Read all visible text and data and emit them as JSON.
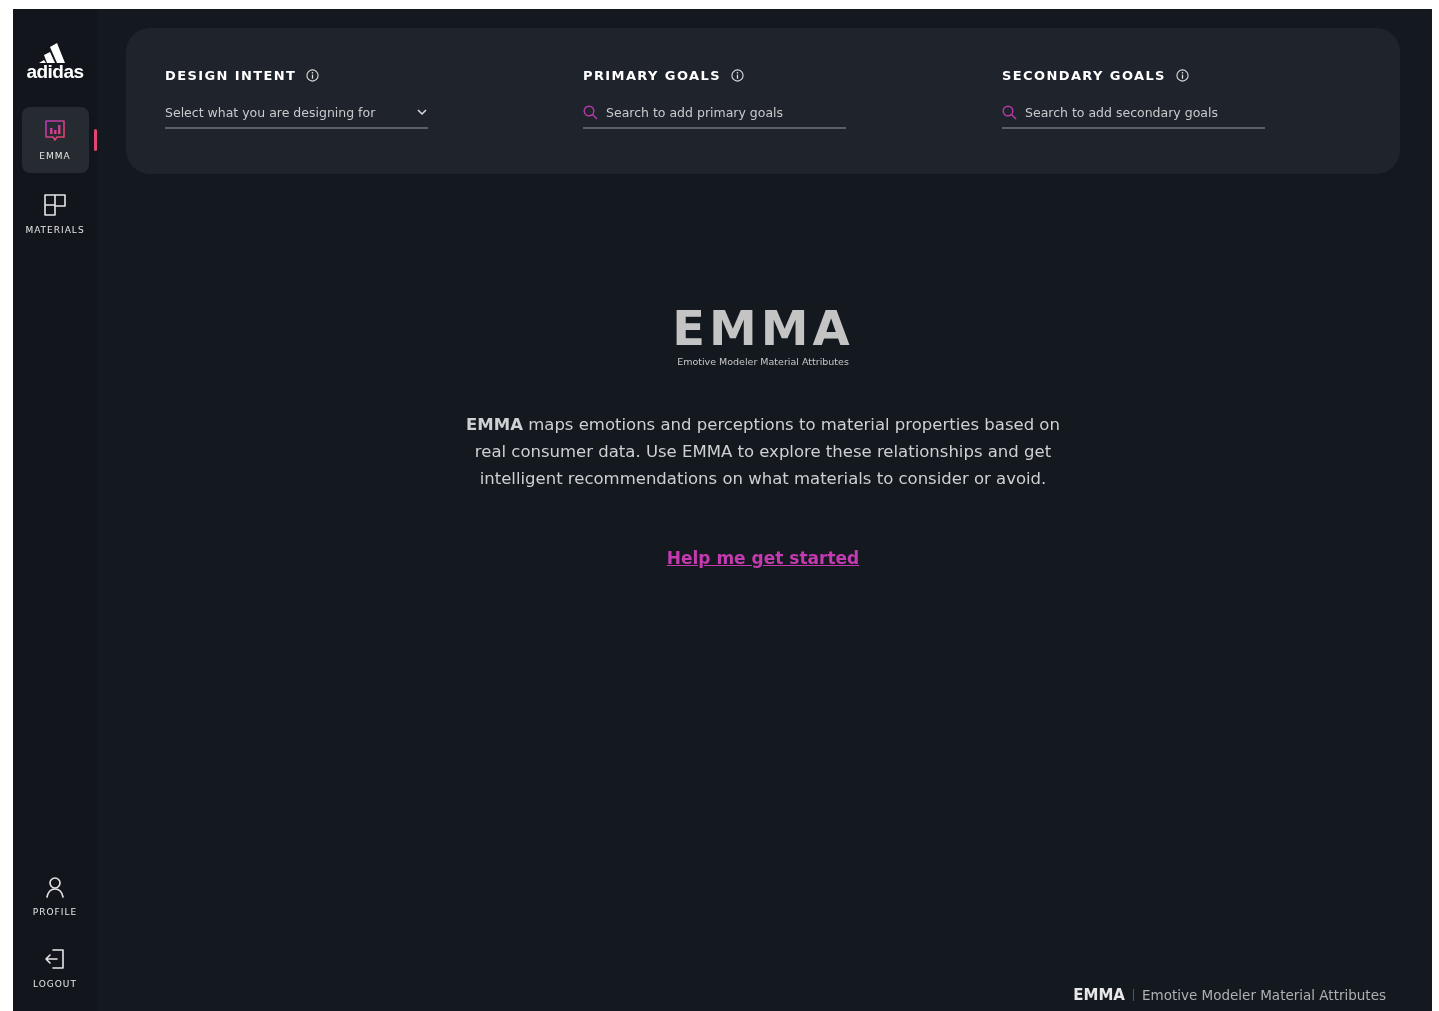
{
  "sidebar": {
    "logo": "adidas",
    "nav": [
      {
        "label": "EMMA",
        "kind": "chart",
        "selected": true
      },
      {
        "label": "MATERIALS",
        "kind": "grid",
        "selected": false
      }
    ],
    "bottom": [
      {
        "label": "PROFILE",
        "kind": "person"
      },
      {
        "label": "LOGOUT",
        "kind": "logout"
      }
    ]
  },
  "filters": [
    {
      "label": "DESIGN INTENT",
      "kind": "select",
      "placeholder": "Select what you are designing for"
    },
    {
      "label": "PRIMARY GOALS",
      "kind": "search",
      "placeholder": "Search to add primary goals"
    },
    {
      "label": "SECONDARY GOALS",
      "kind": "search",
      "placeholder": "Search to add secondary goals"
    }
  ],
  "hero": {
    "title": "EMMA",
    "subtitle": "Emotive Modeler Material Attributes",
    "description": "**EMMA** maps emotions and perceptions to material properties based on real consumer data. Use EMMA to explore these relationships and get intelligent recommendations on what materials to consider or avoid.",
    "link": "Help me get started"
  },
  "footer": {
    "brand": "EMMA",
    "tagline": "Emotive Modeler Material Attributes"
  }
}
